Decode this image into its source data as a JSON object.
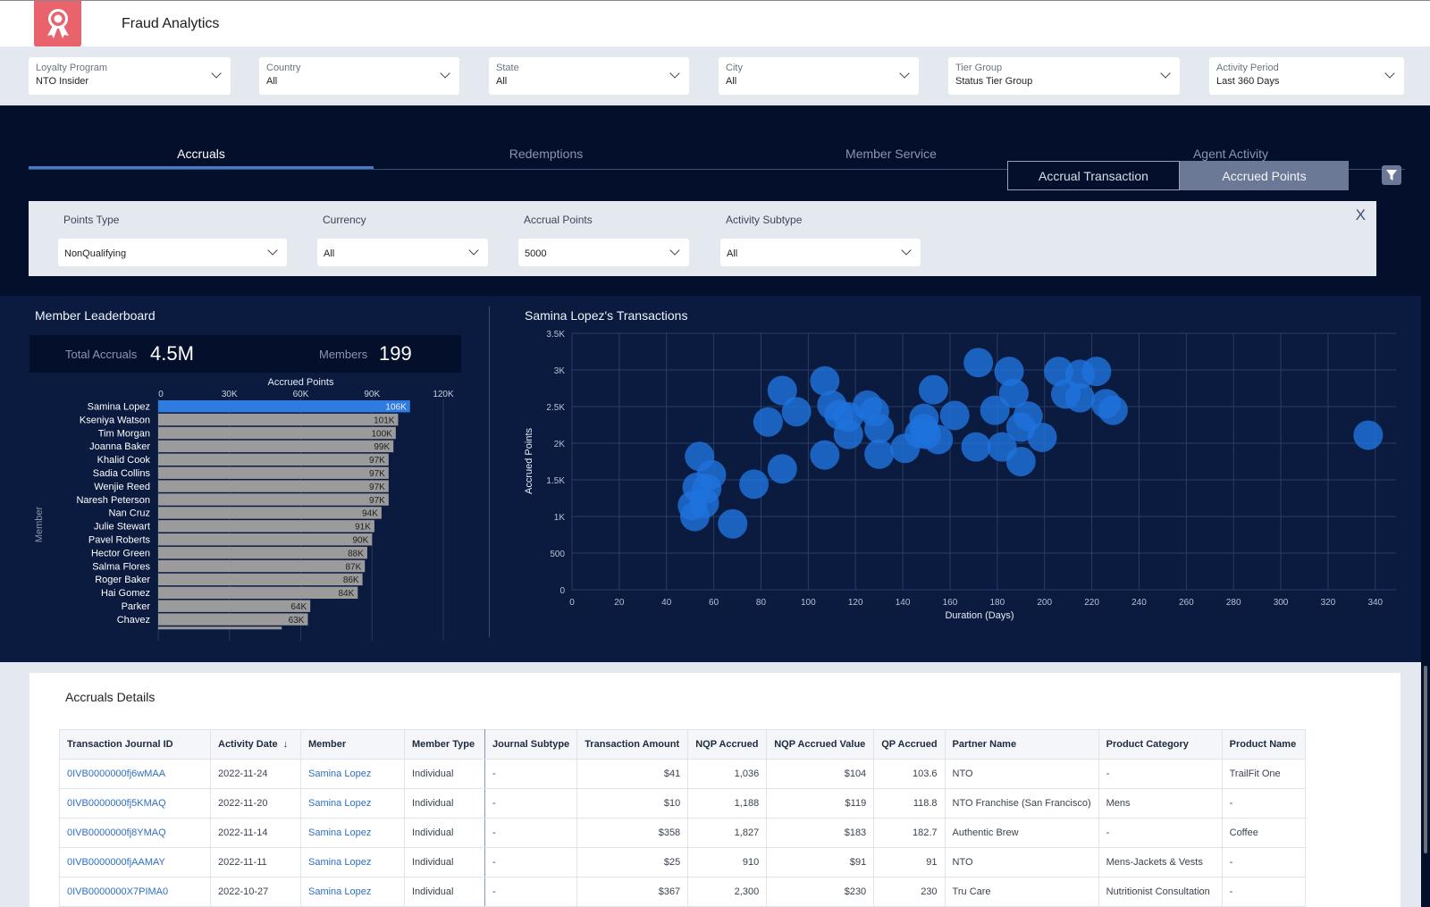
{
  "app": {
    "title": "Fraud Analytics",
    "logo_icon": "award-ribbon-icon",
    "brand_color": "#e8636b"
  },
  "global_filters": [
    {
      "label": "Loyalty Program",
      "value": "NTO Insider"
    },
    {
      "label": "Country",
      "value": "All"
    },
    {
      "label": "State",
      "value": "All"
    },
    {
      "label": "City",
      "value": "All"
    },
    {
      "label": "Tier Group",
      "value": "Status Tier Group"
    },
    {
      "label": "Activity Period",
      "value": "Last 360 Days"
    }
  ],
  "tabs": [
    {
      "label": "Accruals",
      "active": true
    },
    {
      "label": "Redemptions",
      "active": false
    },
    {
      "label": "Member Service",
      "active": false
    },
    {
      "label": "Agent Activity",
      "active": false
    }
  ],
  "view_toggle": {
    "options": [
      "Accrual Transaction",
      "Accrued Points"
    ],
    "selected": "Accrued Points"
  },
  "filter_button_icon": "funnel-icon",
  "sub_filters": {
    "close_label": "X",
    "items": [
      {
        "label": "Points Type",
        "value": "NonQualifying"
      },
      {
        "label": "Currency",
        "value": "All"
      },
      {
        "label": "Accrual Points",
        "value": "5000"
      },
      {
        "label": "Activity Subtype",
        "value": "All"
      }
    ]
  },
  "leaderboard": {
    "title": "Member Leaderboard",
    "kpis": {
      "total_label": "Total Accruals",
      "total_value": "4.5M",
      "members_label": "Members",
      "members_value": "199"
    }
  },
  "transactions": {
    "title": "Samina Lopez's Transactions"
  },
  "chart_data": [
    {
      "type": "bar",
      "orientation": "horizontal",
      "title": "Accrued Points",
      "xlabel": "Accrued Points",
      "ylabel": "Member",
      "xlim": [
        0,
        120000
      ],
      "xticks": [
        "0",
        "30K",
        "60K",
        "90K",
        "120K"
      ],
      "highlight_color": "#2f7be0",
      "bar_color": "#9b9b9b",
      "categories": [
        "Samina Lopez",
        "Kseniya Watson",
        "Tim Morgan",
        "Joanna Baker",
        "Khalid Cook",
        "Sadia Collins",
        "Wenjie Reed",
        "Naresh Peterson",
        "Nan Cruz",
        "Julie Stewart",
        "Pavel Roberts",
        "Hector Green",
        "Salma Flores",
        "Roger Baker",
        "Hai Gomez",
        "Parker",
        "Chavez"
      ],
      "values": [
        106000,
        101000,
        100000,
        99000,
        97000,
        97000,
        97000,
        97000,
        94000,
        91000,
        90000,
        88000,
        87000,
        86000,
        84000,
        64000,
        63000
      ],
      "labels": [
        "106K",
        "101K",
        "100K",
        "99K",
        "97K",
        "97K",
        "97K",
        "97K",
        "94K",
        "91K",
        "90K",
        "88K",
        "87K",
        "86K",
        "84K",
        "64K",
        "63K"
      ],
      "highlighted": "Samina Lopez"
    },
    {
      "type": "scatter",
      "title": "Samina Lopez's Transactions",
      "xlabel": "Duration (Days)",
      "ylabel": "Accrued Points",
      "xlim": [
        0,
        345
      ],
      "ylim": [
        0,
        3500
      ],
      "xticks": [
        "0",
        "20",
        "40",
        "60",
        "80",
        "100",
        "120",
        "140",
        "160",
        "180",
        "200",
        "220",
        "240",
        "260",
        "280",
        "300",
        "320",
        "340"
      ],
      "yticks": [
        "0",
        "500",
        "1K",
        "1.5K",
        "2K",
        "2.5K",
        "3K",
        "3.5K"
      ],
      "grid": true,
      "point_color": "#1f73dc",
      "points": [
        [
          51,
          1150
        ],
        [
          52,
          1000
        ],
        [
          53,
          1400
        ],
        [
          54,
          1820
        ],
        [
          56,
          1180
        ],
        [
          57,
          1380
        ],
        [
          59,
          1570
        ],
        [
          68,
          900
        ],
        [
          77,
          1440
        ],
        [
          89,
          1650
        ],
        [
          89,
          2720
        ],
        [
          83,
          2290
        ],
        [
          95,
          2430
        ],
        [
          107,
          2850
        ],
        [
          107,
          1840
        ],
        [
          110,
          2520
        ],
        [
          113,
          2390
        ],
        [
          117,
          2120
        ],
        [
          117,
          2360
        ],
        [
          125,
          2520
        ],
        [
          128,
          2430
        ],
        [
          130,
          2200
        ],
        [
          130,
          1850
        ],
        [
          141,
          1930
        ],
        [
          147,
          2130
        ],
        [
          149,
          2200
        ],
        [
          149,
          2340
        ],
        [
          150,
          2120
        ],
        [
          155,
          2050
        ],
        [
          153,
          2730
        ],
        [
          162,
          2380
        ],
        [
          171,
          1950
        ],
        [
          172,
          3100
        ],
        [
          179,
          2450
        ],
        [
          182,
          1950
        ],
        [
          185,
          2980
        ],
        [
          187,
          2680
        ],
        [
          190,
          2220
        ],
        [
          190,
          1750
        ],
        [
          193,
          2370
        ],
        [
          199,
          2080
        ],
        [
          206,
          2980
        ],
        [
          209,
          2670
        ],
        [
          215,
          2940
        ],
        [
          215,
          2620
        ],
        [
          222,
          2980
        ],
        [
          226,
          2540
        ],
        [
          229,
          2450
        ],
        [
          337,
          2110
        ]
      ]
    }
  ],
  "details": {
    "title": "Accruals Details",
    "columns": [
      "Transaction Journal ID",
      "Activity Date",
      "Member",
      "Member Type",
      "Journal Subtype",
      "Transaction Amount",
      "NQP Accrued",
      "NQP Accrued Value",
      "QP Accrued",
      "Partner Name",
      "Product Category",
      "Product Name"
    ],
    "sorted_column": "Activity Date",
    "sort_icon": "arrow-down-icon",
    "rows": [
      [
        "0IVB0000000fj6wMAA",
        "2022-11-24",
        "Samina Lopez",
        "Individual",
        "-",
        "$41",
        "1,036",
        "$104",
        "103.6",
        "NTO",
        "-",
        "TrailFit One"
      ],
      [
        "0IVB0000000fj5KMAQ",
        "2022-11-20",
        "Samina Lopez",
        "Individual",
        "-",
        "$10",
        "1,188",
        "$119",
        "118.8",
        "NTO Franchise (San Francisco)",
        "Mens",
        "-"
      ],
      [
        "0IVB0000000fj8YMAQ",
        "2022-11-14",
        "Samina Lopez",
        "Individual",
        "-",
        "$358",
        "1,827",
        "$183",
        "182.7",
        "Authentic Brew",
        "-",
        "Coffee"
      ],
      [
        "0IVB0000000fjAAMAY",
        "2022-11-11",
        "Samina Lopez",
        "Individual",
        "-",
        "$25",
        "910",
        "$91",
        "91",
        "NTO",
        "Mens-Jackets & Vests",
        "-"
      ],
      [
        "0IVB0000000X7PIMA0",
        "2022-10-27",
        "Samina Lopez",
        "Individual",
        "-",
        "$367",
        "2,300",
        "$230",
        "230",
        "Tru Care",
        "Nutritionist Consultation",
        "-"
      ]
    ]
  }
}
